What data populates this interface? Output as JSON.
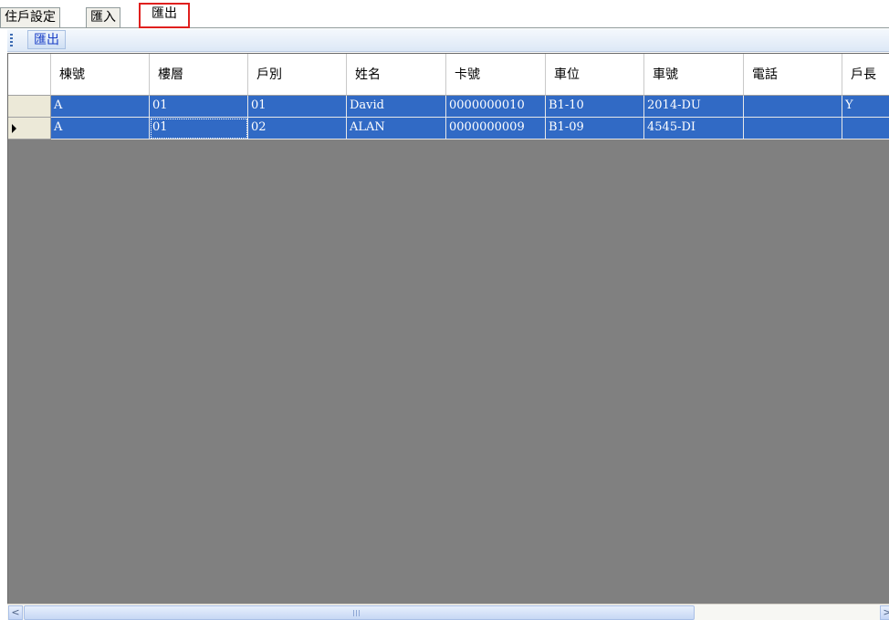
{
  "tabs": [
    {
      "label": "住戶設定"
    },
    {
      "label": "匯入"
    },
    {
      "label": "匯出"
    }
  ],
  "toolbar": {
    "export_label": "匯出"
  },
  "grid": {
    "columns": [
      "棟號",
      "樓層",
      "戶別",
      "姓名",
      "卡號",
      "車位",
      "車號",
      "電話",
      "戶長"
    ],
    "rows": [
      [
        "A",
        "01",
        "01",
        "David",
        "0000000010",
        "B1-10",
        "2014-DU",
        "",
        "Y"
      ],
      [
        "A",
        "01",
        "02",
        "ALAN",
        "0000000009",
        "B1-09",
        "4545-DI",
        "",
        ""
      ]
    ],
    "selected_row_index": 1
  },
  "colors": {
    "selection": "#316ac5",
    "grid_background": "#808080",
    "active_tab_border": "#e0201e"
  },
  "scrollbar": {
    "left_arrow": "<",
    "right_arrow": ">"
  }
}
